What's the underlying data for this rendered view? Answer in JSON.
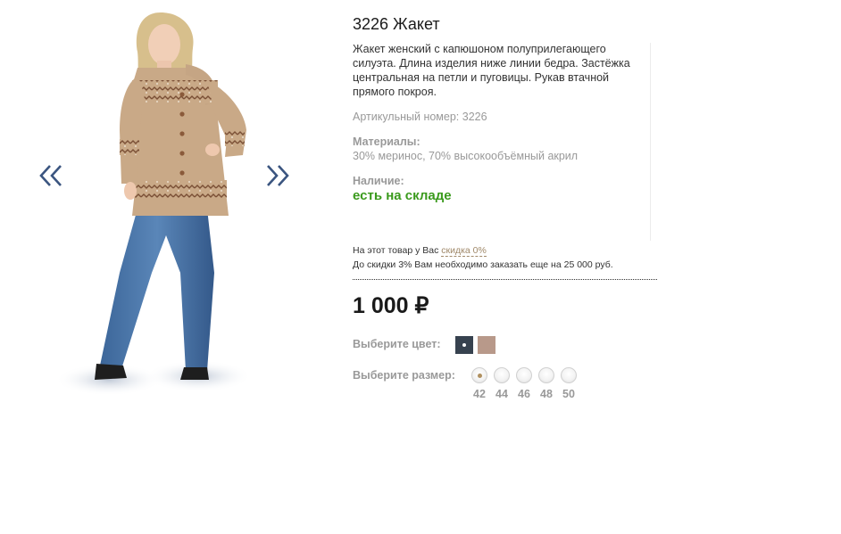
{
  "gallery": {
    "prev_icon": "double-chevron-left-icon",
    "next_icon": "double-chevron-right-icon",
    "image_alt": "Woman wearing knitted beige cardigan with hood and blue jeans"
  },
  "product": {
    "title": "3226 Жакет",
    "description": "Жакет женский с капюшоном полуприлегающего силуэта. Длина изделия ниже линии бедра. Застёжка центральная на петли и пуговицы. Рукав втачной прямого покроя.",
    "sku": "Артикульный номер: 3226",
    "materials_label": "Материалы:",
    "materials_value": "30% меринос, 70% высокообъёмный акрил",
    "availability_label": "Наличие:",
    "availability_value": "есть на складе",
    "discount_text": "На этот товар у Вас",
    "discount_link": "скидка 0%",
    "discount_note": "До скидки 3% Вам необходимо заказать еще на 25 000 руб.",
    "price": "1 000 ₽",
    "color_label": "Выберите цвет:",
    "colors": [
      {
        "name": "dark-slate",
        "hex": "#37424f",
        "selected": true
      },
      {
        "name": "beige",
        "hex": "#b8998a",
        "selected": false
      }
    ],
    "size_label": "Выберите размер:",
    "sizes": [
      {
        "label": "42",
        "selected": true
      },
      {
        "label": "44",
        "selected": false
      },
      {
        "label": "46",
        "selected": false
      },
      {
        "label": "48",
        "selected": false
      },
      {
        "label": "50",
        "selected": false
      }
    ],
    "accent_green": "#3a9a1c"
  }
}
